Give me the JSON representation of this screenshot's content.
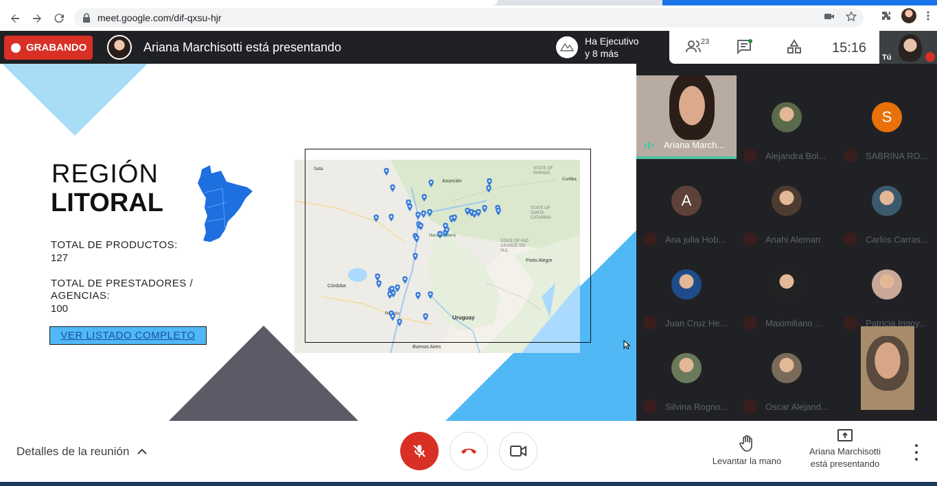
{
  "browser": {
    "url": "meet.google.com/dif-qxsu-hjr"
  },
  "topbar": {
    "recording_label": "GRABANDO",
    "presenting_title": "Ariana Marchisotti está presentando",
    "hand_raise_line1": "Ha Ejecutivo",
    "hand_raise_line2": "y 8 más",
    "participants_count": "23",
    "clock": "15:16",
    "self_label": "Tú"
  },
  "slide": {
    "title_line1": "REGIÓN",
    "title_line2": "LITORAL",
    "products_label": "TOTAL DE PRODUCTOS:",
    "products_value": "127",
    "providers_label_line1": "TOTAL DE PRESTADORES /",
    "providers_label_line2": "AGENCIAS:",
    "providers_value": "100",
    "cta_button": "VER LISTADO COMPLETO",
    "map_labels": {
      "asuncion": "Asunción",
      "cordoba": "Córdoba",
      "uruguay": "Uruguay",
      "porto_alegre": "Porto Alegre",
      "buenos_aires": "Buenos Aires",
      "rosario": "Rosario",
      "parana_state": "STATE OF PARANÁ",
      "santa_catarina": "STATE OF SANTA CATARINA",
      "rio_grande": "STATE OF RIO GRANDE DO SUL",
      "curitiba": "Curitiba",
      "salta": "Salta",
      "ibera": "Nacional Iberá"
    }
  },
  "participants": [
    {
      "name": "Ariana March...",
      "speaking": true
    },
    {
      "name": "Alejandra Bol...",
      "initial": "",
      "color": "#5b6a4a"
    },
    {
      "name": "SABRINA RO...",
      "initial": "S",
      "color": "#e8710a"
    },
    {
      "name": "Ana julia Hob...",
      "initial": "A",
      "color": "#5d4037"
    },
    {
      "name": "Anahi Aleman",
      "initial": "",
      "color": "#4e3b30"
    },
    {
      "name": "Carlos Carras...",
      "initial": "",
      "color": "#3b5a6e"
    },
    {
      "name": "Juan Cruz He...",
      "initial": "",
      "color": "#1e4c8a"
    },
    {
      "name": "Maximiliano ...",
      "initial": "",
      "color": "#222222"
    },
    {
      "name": "Patricia Irigoy...",
      "initial": "",
      "color": "#c9a89a"
    },
    {
      "name": "Silvina Rogno...",
      "initial": "",
      "color": "#6b7a5a"
    },
    {
      "name": "Oscar Alejand...",
      "initial": "",
      "color": "#7a6a5a"
    }
  ],
  "bottombar": {
    "meeting_details": "Detalles de la reunión",
    "raise_hand": "Levantar la mano",
    "present_line1": "Ariana Marchisotti",
    "present_line2": "está presentando"
  },
  "colors": {
    "record_red": "#d93025",
    "slide_light_blue": "#a8dcf7",
    "slide_blue": "#4fb8f5",
    "slide_gray": "#5a5b66",
    "map_pin": "#3b7dd8",
    "speaking_green": "#4fc3a1"
  }
}
